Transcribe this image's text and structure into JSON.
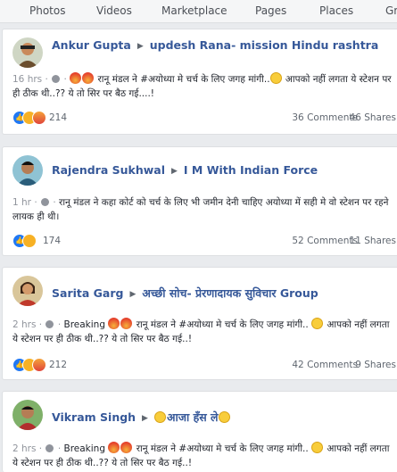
{
  "nav": {
    "items": [
      "Photos",
      "Videos",
      "Marketplace",
      "Pages",
      "Places",
      "Gr"
    ]
  },
  "posts": [
    {
      "author": "Ankur Gupta",
      "group": "updesh Rana- mission Hindu rashtra",
      "time": "16 hrs",
      "text_prefix": "",
      "text": "रानू मंडल ने #अयोध्या मे चर्च के लिए जगह मांगी..",
      "text_after_emoji": "आपको नहीं लगता ये स्टेशन पर ही ठीक थी..?? ये तो सिर पर बैठ गई....!",
      "reaction_count": "214",
      "comments": "36 Comments",
      "shares": "46 Shares"
    },
    {
      "author": "Rajendra Sukhwal",
      "group": "I M With Indian Force",
      "time": "1 hr",
      "text_prefix": "",
      "text": "रानू मंडल ने कहा कोर्ट को चर्च के लिए भी जमीन देनी चाहिए अयोध्या में सही मे वो स्टेशन पर रहने लायक ही थी।",
      "text_after_emoji": "",
      "reaction_count": "174",
      "comments": "52 Comments",
      "shares": "11 Shares"
    },
    {
      "author": "Sarita Garg",
      "group": "अच्छी सोच- प्रेरणादायक सुविचार Group",
      "time": "2 hrs",
      "text_prefix": "Breaking",
      "text": "रानू मंडल ने #अयोध्या मे चर्च के लिए जगह मांगी..",
      "text_after_emoji": "आपको नहीं लगता ये स्टेशन पर ही ठीक थी..?? ये तो सिर पर बैठ गई..!",
      "reaction_count": "212",
      "comments": "42 Comments",
      "shares": "9 Shares"
    },
    {
      "author": "Vikram Singh",
      "group": "आजा हँस ले",
      "time": "2 hrs",
      "text_prefix": "Breaking",
      "text": "रानू मंडल ने #अयोध्या मे चर्च के लिए जगह मांगी..",
      "text_after_emoji": "आपको नहीं लगता ये स्टेशन पर ही ठीक थी..?? ये तो सिर पर बैठ गई..!",
      "reaction_count": "",
      "comments": "",
      "shares": ""
    }
  ],
  "colors": {
    "link": "#365899",
    "like": "#2078f4",
    "angry": "#e0443b",
    "haha": "#f7b125",
    "page_bg": "#e9ebee"
  }
}
